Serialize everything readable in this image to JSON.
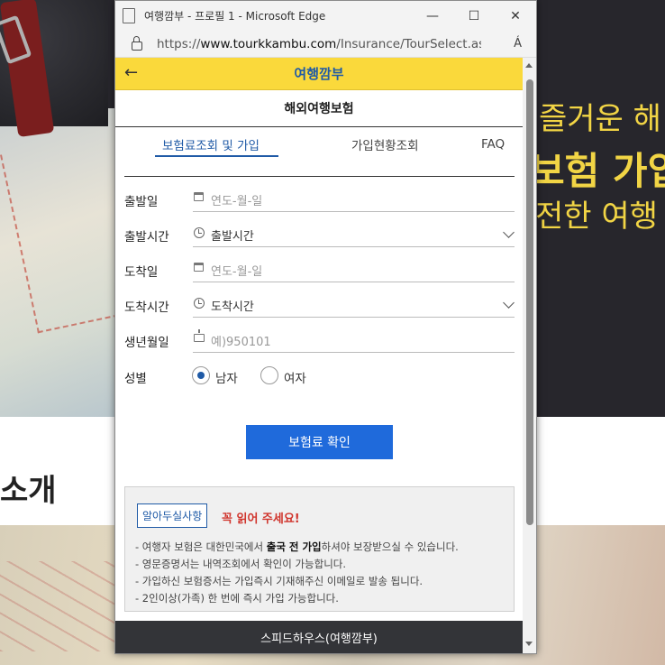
{
  "background": {
    "yellow_lines": [
      "즐거운 해",
      "보험 가입",
      "전한 여행"
    ],
    "section_text": "소개"
  },
  "browser": {
    "window_title": "여행깜부 - 프로필 1 - Microsoft Edge",
    "url_prefix": "https://",
    "url_host": "www.tourkkambu.com",
    "url_path": "/Insurance/TourSelect.aspx?a...",
    "buttons": {
      "minimize": "—",
      "maximize": "☐",
      "close": "✕"
    },
    "read_aloud_icon": "Á"
  },
  "app": {
    "back_icon": "←",
    "title": "여행깜부",
    "subheader": "해외여행보험",
    "tabs": [
      {
        "label": "보험료조회 및 가입",
        "active": true
      },
      {
        "label": "가입현황조회",
        "active": false
      },
      {
        "label": "FAQ",
        "active": false
      }
    ]
  },
  "form": {
    "departure_date": {
      "label": "출발일",
      "placeholder": "연도-월-일"
    },
    "departure_time": {
      "label": "출발시간",
      "value": "출발시간"
    },
    "arrival_date": {
      "label": "도착일",
      "placeholder": "연도-월-일"
    },
    "arrival_time": {
      "label": "도착시간",
      "value": "도착시간"
    },
    "birthdate": {
      "label": "생년월일",
      "placeholder": "예)950101"
    },
    "gender": {
      "label": "성별",
      "options": [
        "남자",
        "여자"
      ],
      "selected": "남자"
    },
    "submit_label": "보험료 확인"
  },
  "notice": {
    "tag": "알아두실사항",
    "heading": "꼭 읽어 주세요!",
    "items": [
      {
        "pre": "- 여행자 보험은 대한민국에서 ",
        "bold": "출국 전 가입",
        "post": "하셔야 보장받으실 수 있습니다."
      },
      {
        "pre": "- 영문증명서는 내역조회에서 확인이 가능합니다.",
        "bold": "",
        "post": ""
      },
      {
        "pre": "- 가입하신 보험증서는 가입즉시 기재해주신 이메일로 발송 됩니다.",
        "bold": "",
        "post": ""
      },
      {
        "pre": "- 2인이상(가족) 한 번에 즉시 가입 가능합니다.",
        "bold": "",
        "post": ""
      }
    ]
  },
  "footer": {
    "text": "스피드하우스(여행깜부)"
  },
  "colors": {
    "accent": "#1f5aa6",
    "appbar": "#fad93b",
    "button": "#1f6adb",
    "warning": "#d0342c",
    "footer": "#333438"
  }
}
